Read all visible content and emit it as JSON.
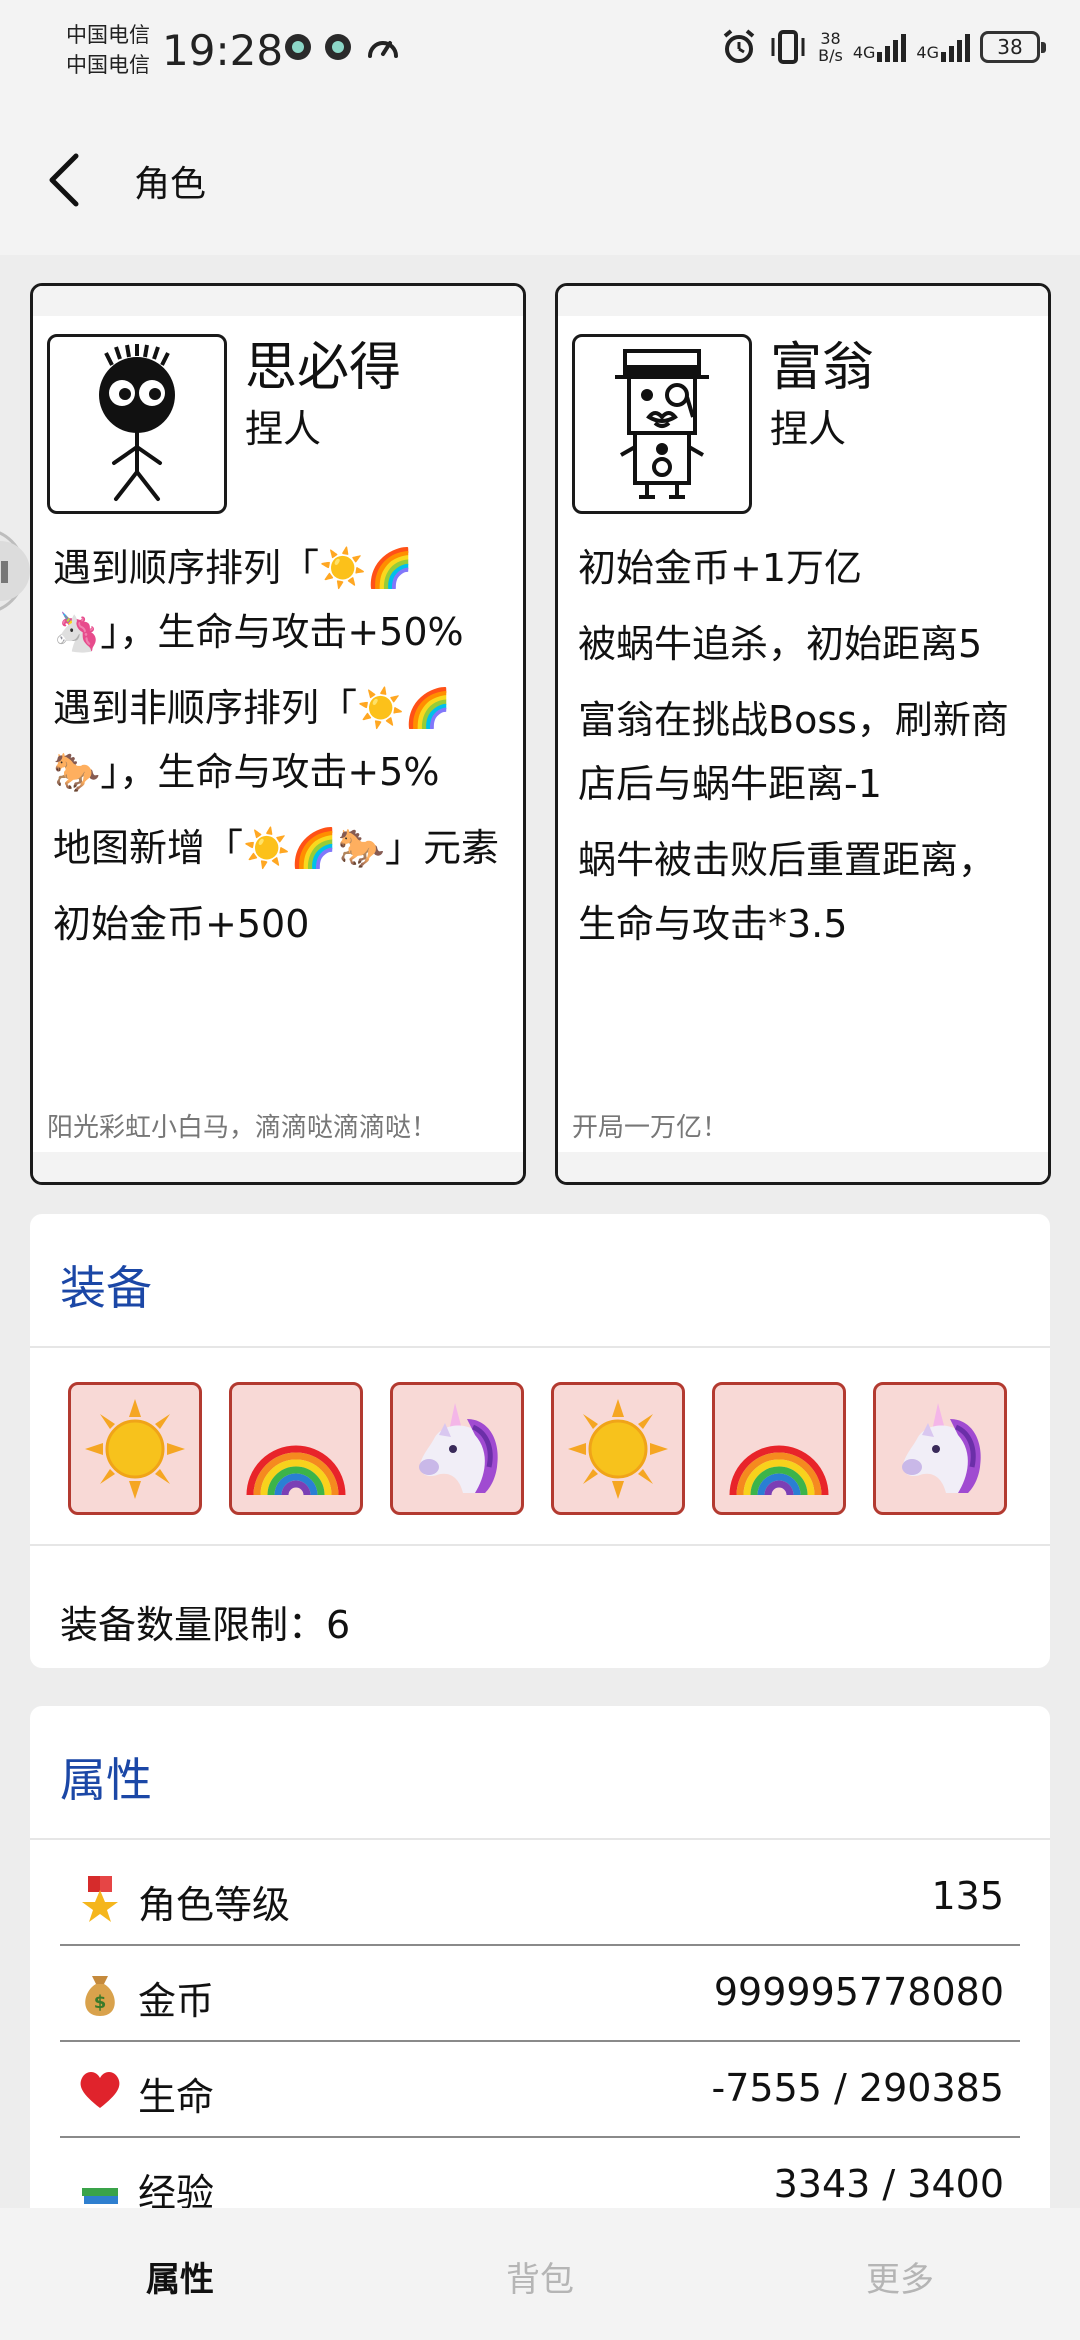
{
  "status_bar": {
    "carrier_1": "中国电信",
    "carrier_2": "中国电信",
    "time": "19:28",
    "net_speed_value": "38",
    "net_speed_unit": "B/s",
    "network_1": "4G",
    "network_2": "4G",
    "battery": "38"
  },
  "header": {
    "title": "角色"
  },
  "characters": [
    {
      "name": "思必得",
      "type": "捏人",
      "abilities": [
        "遇到顺序排列「☀️🌈🦄」，生命与攻击+50%",
        "遇到非顺序排列「☀️🌈🐎」，生命与攻击+5%",
        "地图新增「☀️🌈🐎」元素",
        "初始金币+500"
      ],
      "quote": "阳光彩虹小白马，滴滴哒滴滴哒！"
    },
    {
      "name": "富翁",
      "type": "捏人",
      "abilities": [
        "初始金币+1万亿",
        "被蜗牛追杀，初始距离5",
        "富翁在挑战Boss，刷新商店后与蜗牛距离-1",
        "蜗牛被击败后重置距离，生命与攻击*3.5"
      ],
      "quote": "开局一万亿！"
    }
  ],
  "equipment": {
    "title": "装备",
    "slots": [
      "sun-icon",
      "rainbow-icon",
      "unicorn-icon",
      "sun-icon",
      "rainbow-icon",
      "unicorn-icon"
    ],
    "limit_label": "装备数量限制：",
    "limit_value": "6"
  },
  "attributes": {
    "title": "属性",
    "rows": [
      {
        "icon": "medal-icon",
        "label": "角色等级",
        "value": "135"
      },
      {
        "icon": "money-bag-icon",
        "label": "金币",
        "value": "999995778080"
      },
      {
        "icon": "heart-icon",
        "label": "生命",
        "value": "-7555 / 290385"
      },
      {
        "icon": "books-icon",
        "label": "经验",
        "value": "3343 / 3400"
      }
    ]
  },
  "bottom_nav": {
    "tabs": [
      "属性",
      "背包",
      "更多"
    ],
    "active": "属性"
  },
  "colors": {
    "accent": "#1b47a6",
    "slot_bg": "#f8d9d6",
    "slot_border": "#b33a30"
  }
}
